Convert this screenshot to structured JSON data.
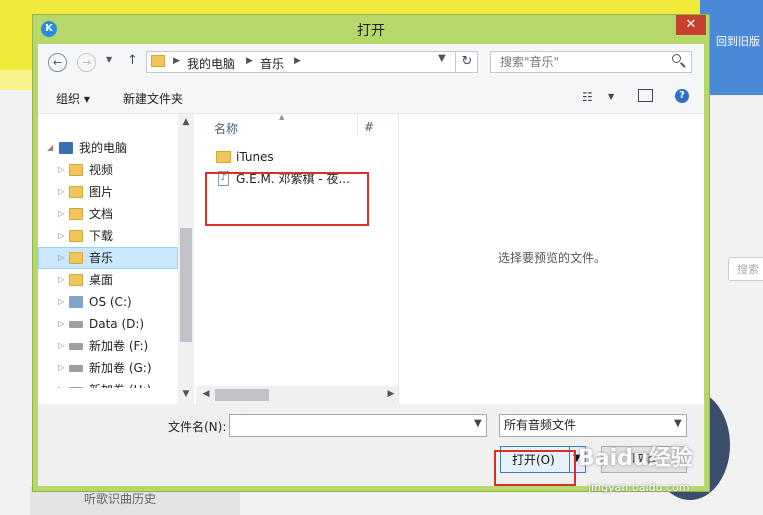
{
  "background_app": {
    "top_right_text": "回到旧版",
    "search_text": "搜索",
    "bottom_item": "听歌识曲历史",
    "colors": {
      "yellow": "#f1ea3a",
      "blue": "#4a89d8"
    }
  },
  "dialog": {
    "app_icon_letter": "K",
    "title": "打开",
    "close_glyph": "✕",
    "accent_color": "#b6d86b"
  },
  "nav": {
    "back": "←",
    "forward": "→",
    "up": "↑",
    "breadcrumb": [
      "我的电脑",
      "音乐"
    ],
    "refresh": "↻",
    "search_placeholder": "搜索\"音乐\""
  },
  "toolbar": {
    "organize": "组织 ▾",
    "new_folder": "新建文件夹",
    "view_icon": "list-view-icon",
    "preview_pane_icon": "preview-pane-icon",
    "help": "?"
  },
  "tree": [
    {
      "label": "我的电脑",
      "icon": "computer-icon",
      "level": 0,
      "expanded": true
    },
    {
      "label": "视频",
      "icon": "video-folder-icon",
      "level": 1
    },
    {
      "label": "图片",
      "icon": "picture-folder-icon",
      "level": 1
    },
    {
      "label": "文档",
      "icon": "document-folder-icon",
      "level": 1
    },
    {
      "label": "下载",
      "icon": "download-folder-icon",
      "level": 1
    },
    {
      "label": "音乐",
      "icon": "music-folder-icon",
      "level": 1,
      "selected": true
    },
    {
      "label": "桌面",
      "icon": "desktop-folder-icon",
      "level": 1
    },
    {
      "label": "OS (C:)",
      "icon": "windows-drive-icon",
      "level": 1
    },
    {
      "label": "Data (D:)",
      "icon": "drive-icon",
      "level": 1
    },
    {
      "label": "新加卷 (F:)",
      "icon": "drive-icon",
      "level": 1
    },
    {
      "label": "新加卷 (G:)",
      "icon": "drive-icon",
      "level": 1
    },
    {
      "label": "新加卷 (H:)",
      "icon": "drive-icon",
      "level": 1
    }
  ],
  "file_list": {
    "columns": [
      "名称",
      "#"
    ],
    "items": [
      {
        "name": "iTunes",
        "icon": "folder-icon"
      },
      {
        "name": "G.E.M. 邓紫棋 - 夜...",
        "icon": "music-file-icon"
      }
    ]
  },
  "preview_message": "选择要预览的文件。",
  "bottom": {
    "filename_label": "文件名(N):",
    "filename_value": "",
    "filetype_value": "所有音频文件",
    "open_label": "打开(O)",
    "cancel_label": "取消"
  },
  "watermark": {
    "text": "Baidu经验",
    "sub": "jingyan.baidu.com"
  }
}
